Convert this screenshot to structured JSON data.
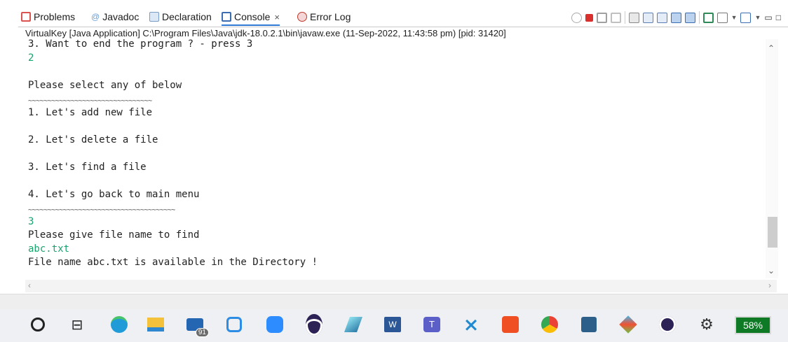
{
  "tabs": [
    {
      "label": "Problems",
      "icon": "problems-icon",
      "color": "#d9534f"
    },
    {
      "label": "Javadoc",
      "icon": "javadoc-icon",
      "color": "#6a9bd1"
    },
    {
      "label": "Declaration",
      "icon": "declaration-icon",
      "color": "#7a9cc6"
    },
    {
      "label": "Console",
      "icon": "console-icon",
      "color": "#3b6db3",
      "close": "×"
    },
    {
      "label": "Error Log",
      "icon": "error-log-icon",
      "color": "#c0392b"
    }
  ],
  "launch_info": "VirtualKey [Java Application] C:\\Program Files\\Java\\jdk-18.0.2.1\\bin\\javaw.exe  (11-Sep-2022, 11:43:58 pm) [pid: 31420]",
  "console": {
    "lines": [
      {
        "text": "3. Want to end the program ? - press 3",
        "kind": "out"
      },
      {
        "text": "2",
        "kind": "in"
      },
      {
        "text": "",
        "kind": "out"
      },
      {
        "text": "Please select any of below",
        "kind": "out"
      },
      {
        "text": "~~~~~~~~~~~~~~~~~~~~~~~~~~~~~~~~",
        "kind": "tilde"
      },
      {
        "text": "1. Let's add new file",
        "kind": "out"
      },
      {
        "text": "",
        "kind": "out"
      },
      {
        "text": "2. Let's delete a file",
        "kind": "out"
      },
      {
        "text": "",
        "kind": "out"
      },
      {
        "text": "3. Let's find a file",
        "kind": "out"
      },
      {
        "text": "",
        "kind": "out"
      },
      {
        "text": "4. Let's go back to main menu",
        "kind": "out"
      },
      {
        "text": "~~~~~~~~~~~~~~~~~~~~~~~~~~~~~~~~~~~~~~",
        "kind": "tilde"
      },
      {
        "text": "3",
        "kind": "in"
      },
      {
        "text": "Please give file name to find",
        "kind": "out"
      },
      {
        "text": "abc.txt",
        "kind": "in"
      },
      {
        "text": "File name abc.txt is available in the Directory !",
        "kind": "out"
      }
    ]
  },
  "colors": {
    "input_text": "#18a36f",
    "console_text": "#222222",
    "active_tab_underline": "#2f7ad6",
    "battery_bg": "#0f7a25"
  },
  "taskbar": {
    "items": [
      {
        "name": "search-icon"
      },
      {
        "name": "task-view-icon"
      },
      {
        "name": "edge-icon"
      },
      {
        "name": "file-explorer-icon"
      },
      {
        "name": "mail-icon",
        "badge": "91"
      },
      {
        "name": "app-icon"
      },
      {
        "name": "zoom-icon"
      },
      {
        "name": "eclipse-icon"
      },
      {
        "name": "pen-tool-icon"
      },
      {
        "name": "word-icon"
      },
      {
        "name": "teams-icon"
      },
      {
        "name": "vscode-icon"
      },
      {
        "name": "office-app-icon"
      },
      {
        "name": "chrome-icon"
      },
      {
        "name": "remote-desktop-icon"
      },
      {
        "name": "git-icon"
      },
      {
        "name": "eclipse-icon-2"
      },
      {
        "name": "settings-gear-icon"
      }
    ],
    "battery": "58%"
  }
}
